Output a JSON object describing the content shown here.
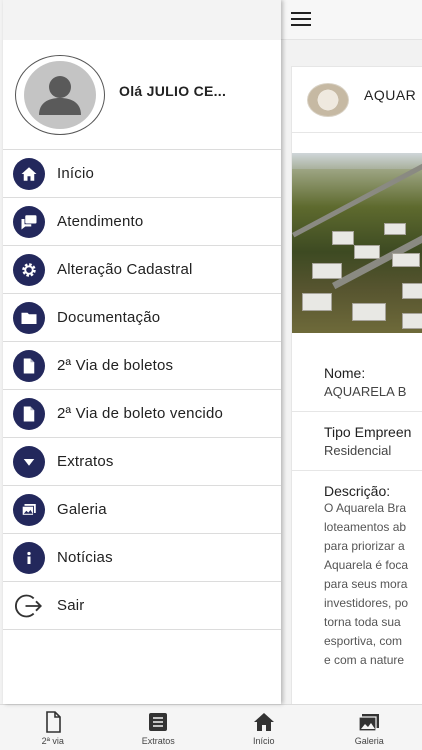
{
  "drawer": {
    "greeting": "Olá JULIO CE...",
    "items": [
      {
        "label": "Início"
      },
      {
        "label": "Atendimento"
      },
      {
        "label": "Alteração Cadastral"
      },
      {
        "label": "Documentação"
      },
      {
        "label": "2ª Via de boletos"
      },
      {
        "label": "2ª Via de boleto vencido"
      },
      {
        "label": "Extratos"
      },
      {
        "label": "Galeria"
      },
      {
        "label": "Notícias"
      },
      {
        "label": "Sair"
      }
    ],
    "icon_color": "#23285c"
  },
  "background": {
    "card_title": "AQUAR",
    "fields": {
      "nome_label": "Nome:",
      "nome_value": "AQUARELA B",
      "tipo_label": "Tipo Empreen",
      "tipo_value": "Residencial",
      "descricao_label": "Descrição:",
      "descricao_lines": [
        "O Aquarela Bra",
        "loteamentos ab",
        "para priorizar a",
        "Aquarela é foca",
        "para seus mora",
        "investidores, po",
        "torna toda sua",
        "esportiva, com",
        "e com a nature"
      ]
    }
  },
  "bottom_nav": {
    "items": [
      {
        "label": "2ª via"
      },
      {
        "label": "Extratos"
      },
      {
        "label": "Início"
      },
      {
        "label": "Galeria"
      }
    ]
  }
}
